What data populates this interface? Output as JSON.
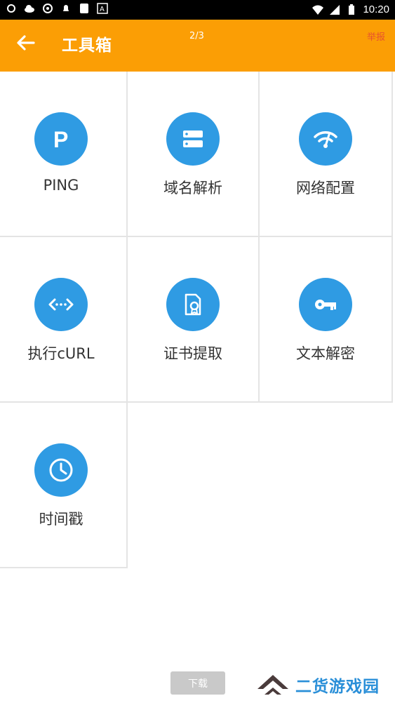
{
  "status_bar": {
    "time": "10:20"
  },
  "header": {
    "title": "工具箱",
    "pager": "2/3",
    "report": "举报"
  },
  "tools": [
    {
      "label": "PING",
      "icon": "ping-icon"
    },
    {
      "label": "域名解析",
      "icon": "server-icon"
    },
    {
      "label": "网络配置",
      "icon": "wifi-icon"
    },
    {
      "label": "执行cURL",
      "icon": "code-icon"
    },
    {
      "label": "证书提取",
      "icon": "certificate-icon"
    },
    {
      "label": "文本解密",
      "icon": "key-icon"
    },
    {
      "label": "时间戳",
      "icon": "clock-icon"
    }
  ],
  "download_button": "下载",
  "watermark": "二货游戏园",
  "colors": {
    "accent": "#fb9e05",
    "icon_bg": "#2f9be3",
    "report": "#e8532e"
  }
}
